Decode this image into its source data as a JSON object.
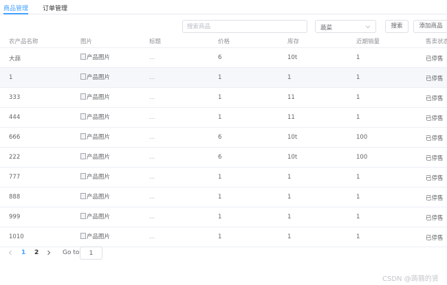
{
  "tabs": [
    {
      "label": "商品管理",
      "active": true
    },
    {
      "label": "订单管理",
      "active": false
    }
  ],
  "toolbar": {
    "search_placeholder": "搜索商品",
    "search_value": "",
    "category_value": "蔬菜",
    "search_button": "搜索",
    "add_button": "添加商品"
  },
  "table": {
    "headers": [
      "农产品名称",
      "图片",
      "标题",
      "价格",
      "库存",
      "近期销量",
      "售卖状态"
    ],
    "image_alt": "产品图片",
    "rows": [
      {
        "name": "大蒜",
        "title": "...",
        "price": "6",
        "stock": "10t",
        "sales": "1",
        "status": "已停售"
      },
      {
        "name": "1",
        "title": "...",
        "price": "1",
        "stock": "1",
        "sales": "1",
        "status": "已停售"
      },
      {
        "name": "333",
        "title": "...",
        "price": "1",
        "stock": "11",
        "sales": "1",
        "status": "已停售"
      },
      {
        "name": "444",
        "title": "...",
        "price": "1",
        "stock": "11",
        "sales": "1",
        "status": "已停售"
      },
      {
        "name": "666",
        "title": "...",
        "price": "6",
        "stock": "10t",
        "sales": "100",
        "status": "已停售"
      },
      {
        "name": "222",
        "title": "...",
        "price": "6",
        "stock": "10t",
        "sales": "100",
        "status": "已停售"
      },
      {
        "name": "777",
        "title": "...",
        "price": "1",
        "stock": "1",
        "sales": "1",
        "status": "已停售"
      },
      {
        "name": "888",
        "title": "...",
        "price": "1",
        "stock": "1",
        "sales": "1",
        "status": "已停售"
      },
      {
        "name": "999",
        "title": "...",
        "price": "1",
        "stock": "1",
        "sales": "1",
        "status": "已停售"
      },
      {
        "name": "1010",
        "title": "...",
        "price": "1",
        "stock": "1",
        "sales": "1",
        "status": "已停售"
      }
    ]
  },
  "pagination": {
    "pages": [
      "1",
      "2"
    ],
    "current_page": "1",
    "goto_label": "Go to",
    "goto_value": "1"
  },
  "watermark": "CSDN @蒟蒻的贤",
  "colors": {
    "accent": "#409eff",
    "border": "#dcdfe6",
    "header_text": "#909399",
    "row_hover": "#f5f7fa"
  }
}
